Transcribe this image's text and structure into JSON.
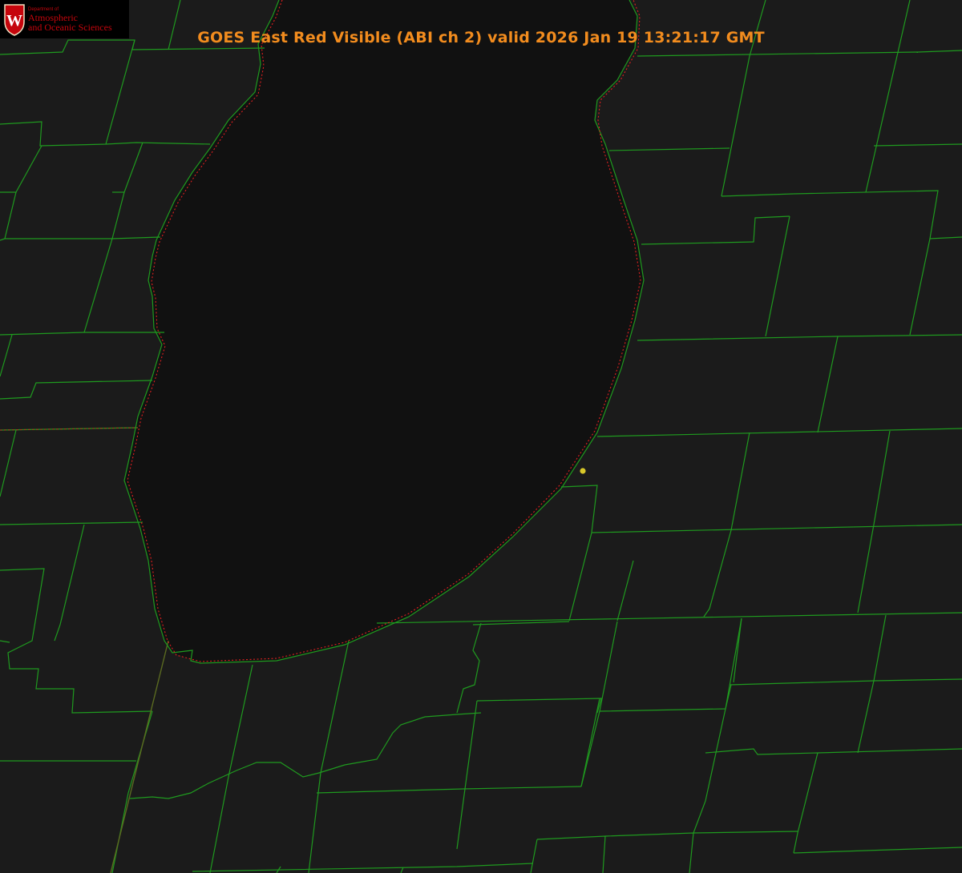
{
  "header": {
    "title": "GOES East Red Visible (ABI ch 2) valid 2026 Jan 19 13:21:17 GMT"
  },
  "logo": {
    "dept": "Department of",
    "line1": "Atmospheric",
    "line2": "and Oceanic Sciences",
    "crest_letter": "W",
    "color": "#c5050c"
  },
  "map": {
    "county_line_color": "#1f9a1f",
    "shoreline_color": "#e02020",
    "marker_color": "#d8c82a",
    "background_color": "#1b1b1b",
    "lake_color": "#111111"
  }
}
